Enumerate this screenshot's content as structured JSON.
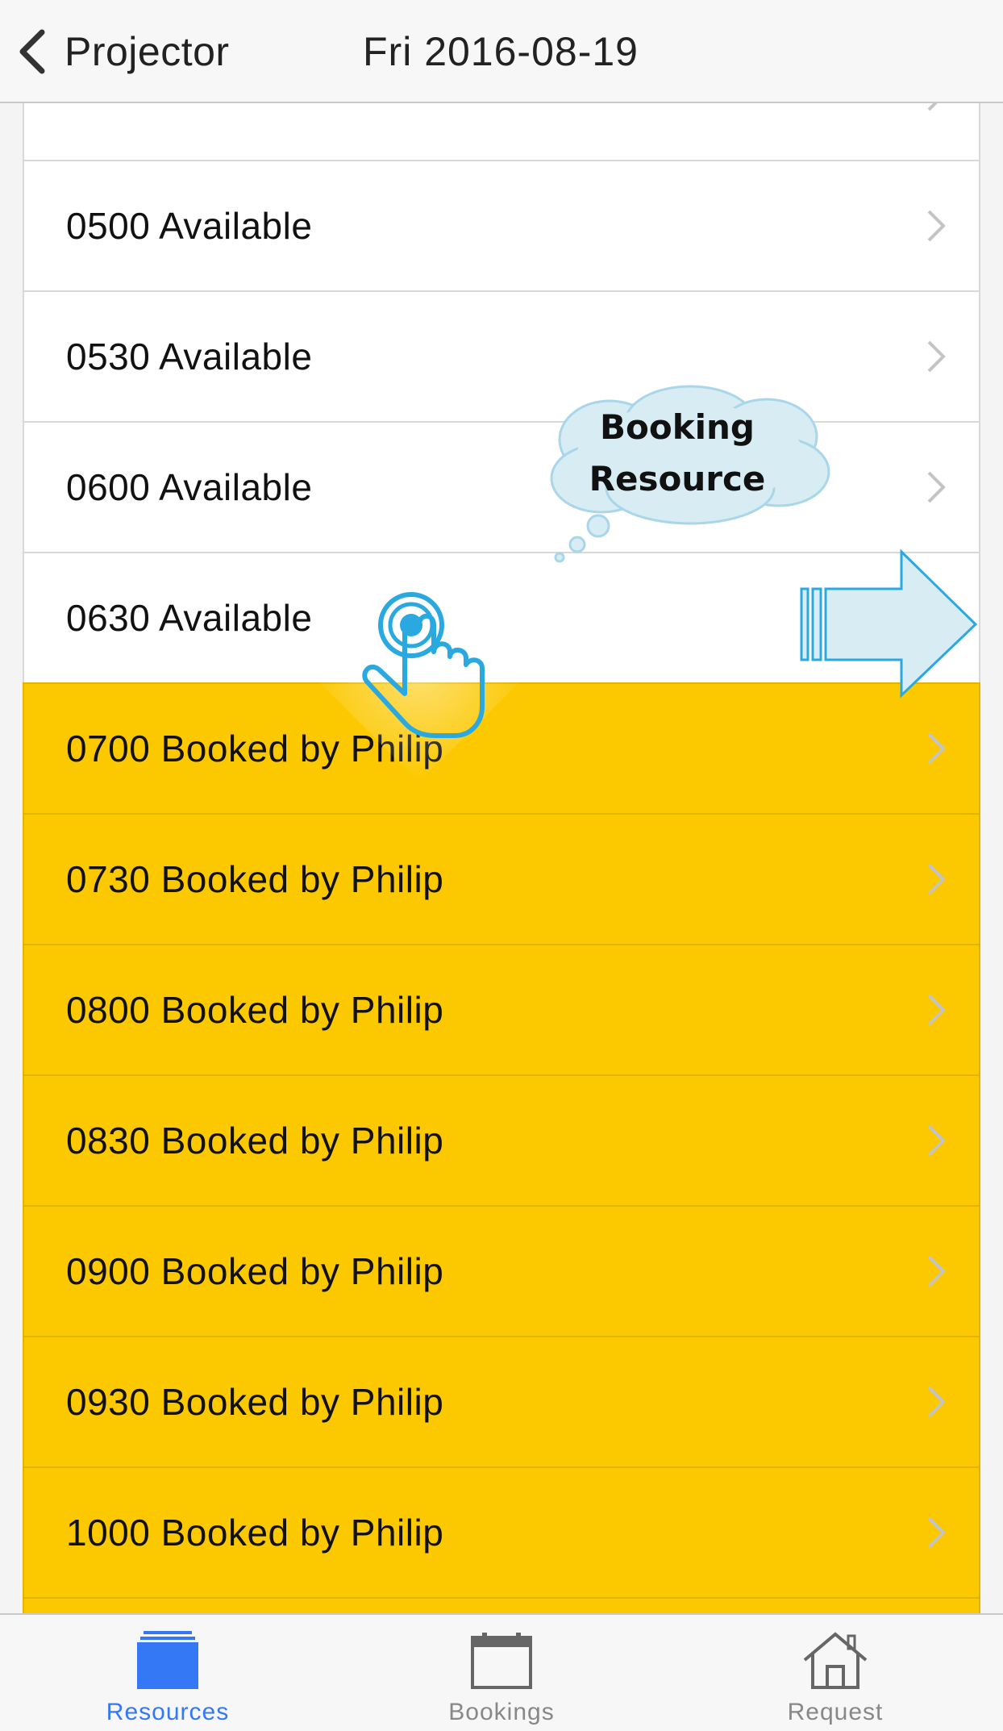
{
  "header": {
    "back_label": "Projector",
    "title": "Fri 2016-08-19"
  },
  "slots": [
    {
      "label": "",
      "status": "available"
    },
    {
      "label": "0500 Available",
      "status": "available"
    },
    {
      "label": "0530 Available",
      "status": "available"
    },
    {
      "label": "0600 Available",
      "status": "available"
    },
    {
      "label": "0630 Available",
      "status": "available"
    },
    {
      "label": "0700 Booked by Philip",
      "status": "booked"
    },
    {
      "label": "0730 Booked by Philip",
      "status": "booked"
    },
    {
      "label": "0800 Booked by Philip",
      "status": "booked"
    },
    {
      "label": "0830 Booked by Philip",
      "status": "booked"
    },
    {
      "label": "0900 Booked by Philip",
      "status": "booked"
    },
    {
      "label": "0930 Booked by Philip",
      "status": "booked"
    },
    {
      "label": "1000 Booked by Philip",
      "status": "booked"
    },
    {
      "label": "",
      "status": "booked"
    }
  ],
  "callout": {
    "text": "Booking\nResource"
  },
  "tabs": [
    {
      "label": "Resources",
      "icon": "stack-icon",
      "active": true
    },
    {
      "label": "Bookings",
      "icon": "calendar-icon",
      "active": false
    },
    {
      "label": "Request",
      "icon": "house-icon",
      "active": false
    }
  ],
  "colors": {
    "booked": "#fcc800",
    "available": "#ffffff",
    "accent": "#3478f6",
    "annotation": "#2aa9e0"
  }
}
